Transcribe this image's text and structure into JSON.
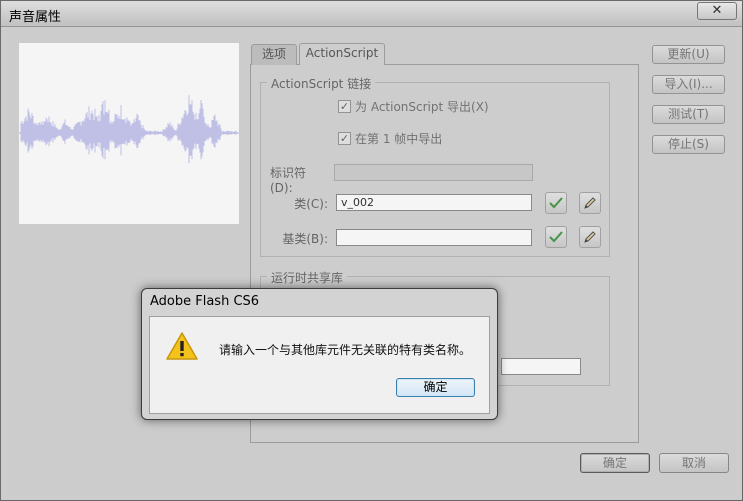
{
  "window": {
    "title": "声音属性",
    "close_label": "✕"
  },
  "tabs": [
    {
      "label": "选项",
      "active": false
    },
    {
      "label": "ActionScript",
      "active": true
    }
  ],
  "linkage": {
    "group_label": "ActionScript 链接",
    "export_for_as": {
      "label": "为 ActionScript 导出(X)",
      "checked": true
    },
    "export_first_frame": {
      "label": "在第 1 帧中导出",
      "checked": true
    },
    "identifier": {
      "label": "标识符(D):",
      "value": ""
    },
    "class": {
      "label": "类(C):",
      "value": "v_002"
    },
    "base_class": {
      "label": "基类(B):",
      "value": ""
    }
  },
  "shared_library": {
    "group_label": "运行时共享库"
  },
  "side_buttons": {
    "update": "更新(U)",
    "import": "导入(I)...",
    "test": "测试(T)",
    "stop": "停止(S)"
  },
  "bottom_buttons": {
    "ok": "确定",
    "cancel": "取消"
  },
  "alert": {
    "title": "Adobe Flash CS6",
    "message": "请输入一个与其他库元件无关联的特有类名称。",
    "ok": "确定",
    "icon": "warning-icon"
  },
  "colors": {
    "waveform": "#c8c8f0",
    "waveform_axis": "#b4b4e6",
    "warning_fill": "#f4c21a",
    "validate_check": "#3c9c3c"
  }
}
